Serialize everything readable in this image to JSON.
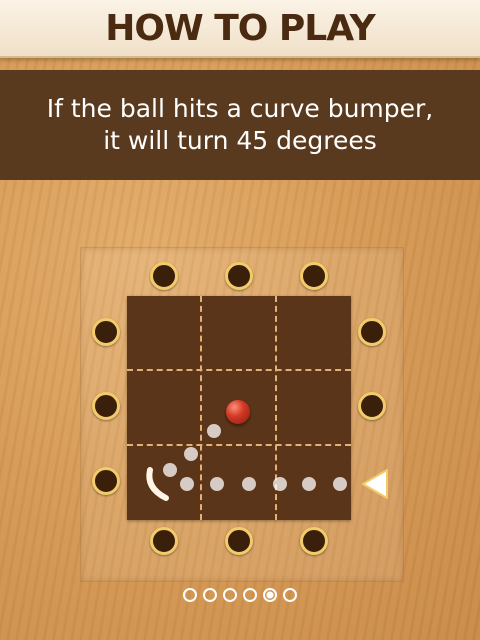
{
  "header": {
    "title": "HOW TO PLAY"
  },
  "instructions": {
    "line1": "If the ball hits a curve bumper,",
    "line2": "it will turn 45 degrees"
  },
  "board": {
    "grid_size": 3,
    "holes_per_side": 3,
    "ball": {
      "color": "red"
    },
    "launcher_icon": "triangle-arrow-left-icon",
    "bumper_icon": "curve-bumper-icon",
    "trajectory_dot_count": 9
  },
  "pager": {
    "total": 6,
    "current": 5
  },
  "colors": {
    "wood": "#d79a55",
    "panel": "#5a3a1e",
    "grid": "#5b3519",
    "grid_line": "#e2b173",
    "hole_ring": "#f2cc6a",
    "title_text": "#4a2a10"
  }
}
